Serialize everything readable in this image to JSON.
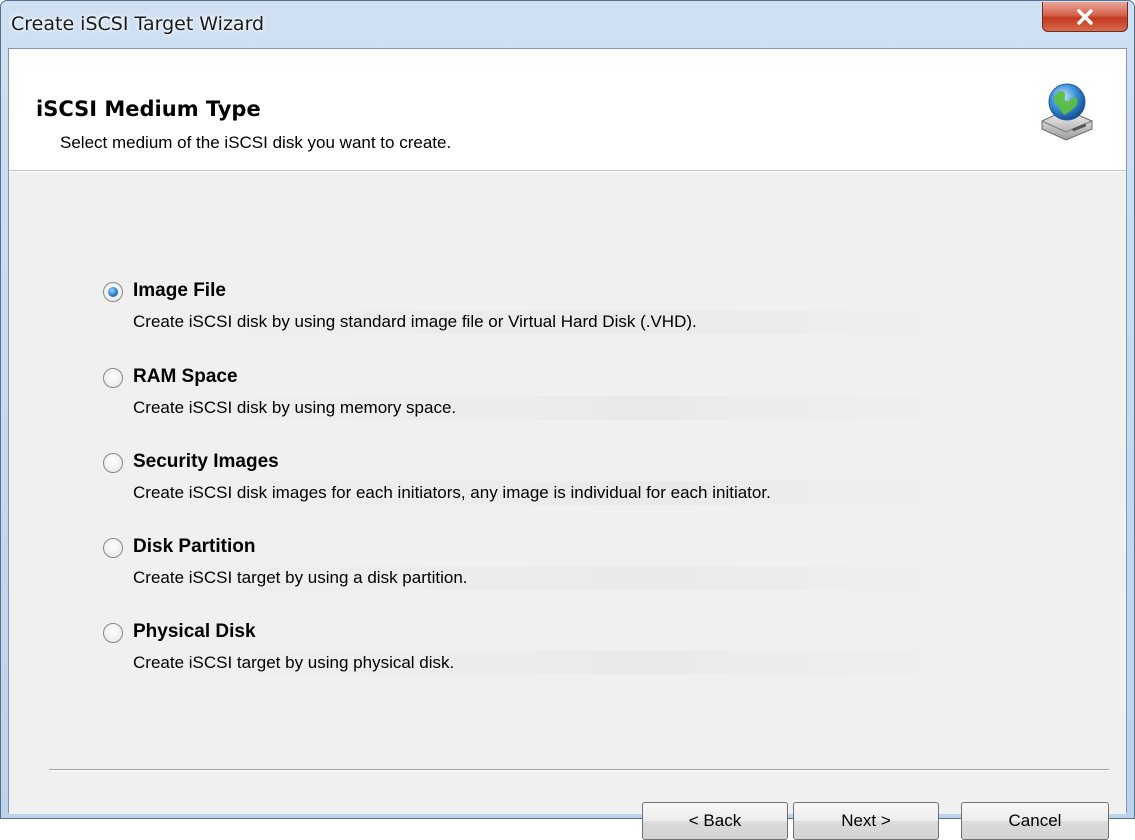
{
  "window": {
    "title": "Create iSCSI Target Wizard",
    "close_glyph": "×"
  },
  "header": {
    "title": "iSCSI Medium Type",
    "subtitle": "Select medium of the iSCSI disk you want to create.",
    "icon": "globe-disk-icon"
  },
  "options": [
    {
      "label": "Image File",
      "description": "Create iSCSI disk by using standard image file or Virtual Hard Disk (.VHD).",
      "selected": true
    },
    {
      "label": "RAM Space",
      "description": "Create iSCSI disk by using memory space.",
      "selected": false
    },
    {
      "label": "Security Images",
      "description": "Create iSCSI disk images for each initiators, any image is individual for each initiator.",
      "selected": false
    },
    {
      "label": "Disk Partition",
      "description": "Create iSCSI target by using a disk partition.",
      "selected": false
    },
    {
      "label": "Physical Disk",
      "description": "Create iSCSI target by using physical disk.",
      "selected": false
    }
  ],
  "buttons": {
    "back": "< Back",
    "next": "Next >",
    "cancel": "Cancel"
  },
  "colors": {
    "titlebar": "#bcd3ec",
    "close_button": "#c2391f",
    "radio_selected": "#2b7bd3"
  }
}
